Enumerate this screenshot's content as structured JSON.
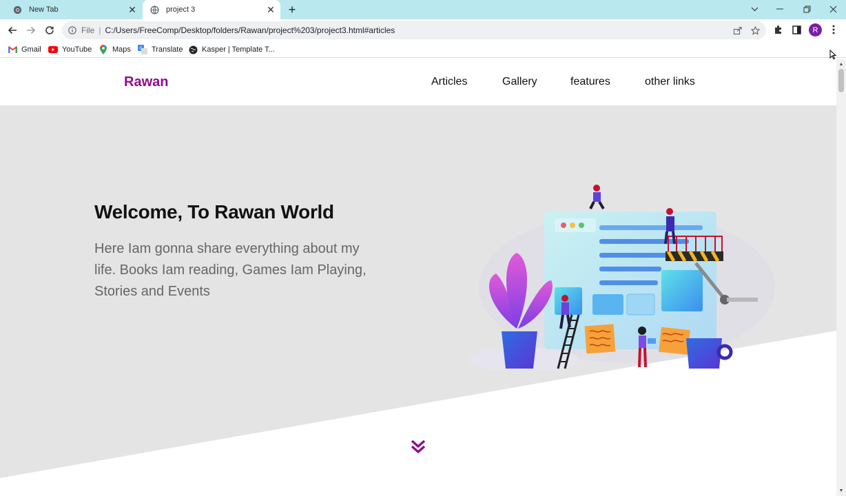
{
  "browser": {
    "tabs": [
      {
        "title": "New Tab",
        "active": false
      },
      {
        "title": "project 3",
        "active": true
      }
    ],
    "address": {
      "scheme": "File",
      "url": "C:/Users/FreeComp/Desktop/folders/Rawan/project%203/project3.html#articles"
    },
    "profile_initial": "R",
    "bookmarks": [
      {
        "label": "Gmail",
        "icon": "gmail-icon"
      },
      {
        "label": "YouTube",
        "icon": "youtube-icon"
      },
      {
        "label": "Maps",
        "icon": "maps-icon"
      },
      {
        "label": "Translate",
        "icon": "translate-icon"
      },
      {
        "label": "Kasper | Template T...",
        "icon": "globe-icon"
      }
    ]
  },
  "site": {
    "logo": "Rawan",
    "nav": [
      "Articles",
      "Gallery",
      "features",
      "other links"
    ],
    "hero": {
      "title": "Welcome, To Rawan World",
      "text": "Here Iam gonna share everything about my life. Books Iam reading, Games Iam Playing, Stories and Events"
    }
  },
  "colors": {
    "brand": "#8e0c8e",
    "hero_bg": "#e5e4e5",
    "tab_strip": "#b9e8ef"
  }
}
